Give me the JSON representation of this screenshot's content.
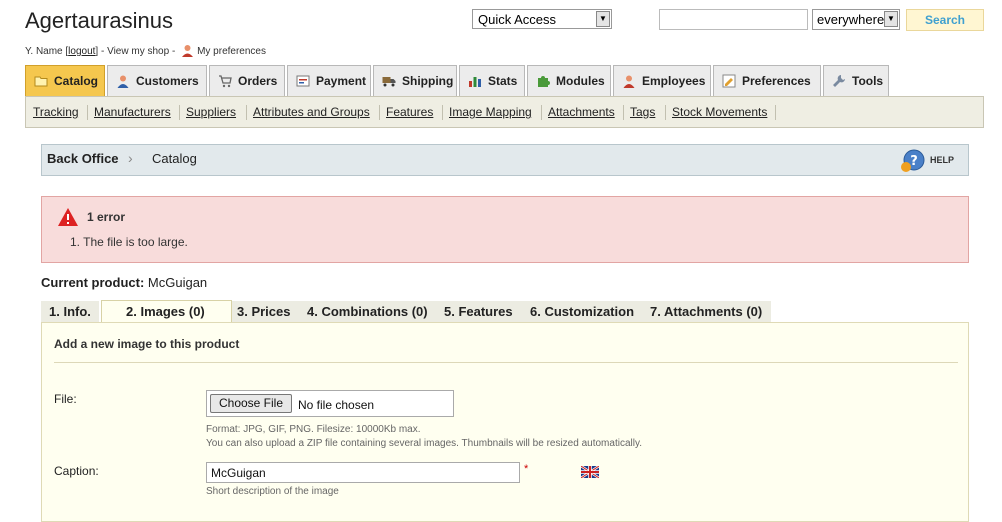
{
  "header": {
    "shop_name": "Agertaurasinus",
    "user_name": "Y. Name [",
    "logout": "logout",
    "after_logout": "] - ",
    "view_shop": "View my shop",
    "separator": " - ",
    "preferences": "My preferences",
    "quick_access": "Quick Access",
    "search_value": "",
    "search_scope": "everywhere",
    "search_button": "Search"
  },
  "tabs": [
    {
      "label": "Catalog",
      "icon": "folder-icon",
      "active": true
    },
    {
      "label": "Customers",
      "icon": "customers-icon",
      "active": false
    },
    {
      "label": "Orders",
      "icon": "cart-icon",
      "active": false
    },
    {
      "label": "Payment",
      "icon": "payment-icon",
      "active": false
    },
    {
      "label": "Shipping",
      "icon": "truck-icon",
      "active": false
    },
    {
      "label": "Stats",
      "icon": "stats-icon",
      "active": false
    },
    {
      "label": "Modules",
      "icon": "puzzle-icon",
      "active": false
    },
    {
      "label": "Employees",
      "icon": "employees-icon",
      "active": false
    },
    {
      "label": "Preferences",
      "icon": "preferences-icon",
      "active": false
    },
    {
      "label": "Tools",
      "icon": "wrench-icon",
      "active": false
    }
  ],
  "subnav": [
    "Tracking",
    "Manufacturers",
    "Suppliers",
    "Attributes and Groups",
    "Features",
    "Image Mapping",
    "Attachments",
    "Tags",
    "Stock Movements"
  ],
  "breadcrumb": {
    "root": "Back Office",
    "current": "Catalog",
    "help": "HELP"
  },
  "error": {
    "title": "1 error",
    "items": [
      "1.  The file is too large."
    ]
  },
  "product": {
    "label": "Current product:",
    "name": "McGuigan"
  },
  "product_tabs": [
    "1. Info.",
    "2. Images (0)",
    "3. Prices",
    "4. Combinations (0)",
    "5. Features",
    "6. Customization",
    "7. Attachments (0)"
  ],
  "active_product_tab": 1,
  "image_form": {
    "heading": "Add a new image to this product",
    "file_label": "File:",
    "choose_file": "Choose File",
    "no_file": "No file chosen",
    "format_hint": "Format: JPG, GIF, PNG. Filesize: 10000Kb max.",
    "zip_hint": "You can also upload a ZIP file containing several images. Thumbnails will be resized automatically.",
    "caption_label": "Caption:",
    "caption_value": "McGuigan",
    "required_mark": "*",
    "caption_hint": "Short description of the image"
  },
  "colors": {
    "active_tab": "#f5c74e",
    "error_bg": "#f8dcdb",
    "panel_bg": "#fffff0",
    "search_text": "#3fa0d0"
  }
}
